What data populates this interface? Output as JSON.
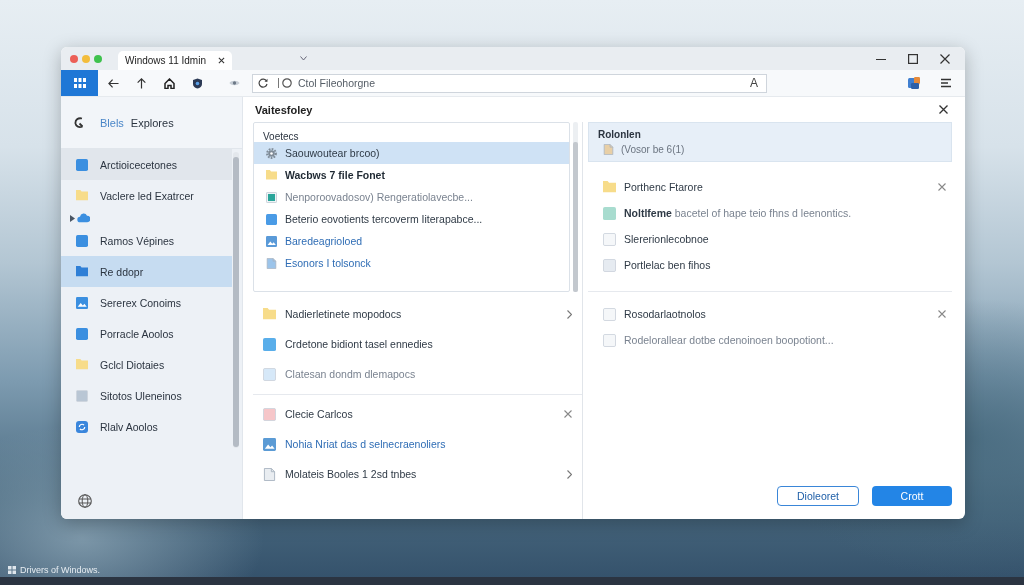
{
  "window": {
    "tabs": [
      {
        "label": "Windows 11 Idmin",
        "selected": true
      }
    ]
  },
  "toolbar": {
    "address": "Ctol Fileohorgne",
    "reader_glyph": "A"
  },
  "sidebar": {
    "link": "Blels",
    "title": "Explores",
    "items": [
      {
        "kind": "item",
        "label": "Arctioicecetones",
        "color": "#3b8fe0",
        "selected": false,
        "hovered": true
      },
      {
        "kind": "item",
        "label": "Vaclere led Exatrcer",
        "color": "#f7dc8a",
        "selected": false,
        "hovered": false
      },
      {
        "kind": "expander",
        "color": "#3b8fe0",
        "expanded": false
      },
      {
        "kind": "item",
        "label": "Ramos Vépines",
        "color": "#3b8fe0",
        "selected": false,
        "hovered": false
      },
      {
        "kind": "item",
        "label": "Re ddopr",
        "color": "#2f7fd6",
        "selected": true,
        "hovered": false
      },
      {
        "kind": "item",
        "label": "Sererex Conoims",
        "color": "#3b8fe0",
        "selected": false,
        "hovered": false
      },
      {
        "kind": "item",
        "label": "Porracle Aoolos",
        "color": "#3b8fe0",
        "selected": false,
        "hovered": false
      },
      {
        "kind": "item",
        "label": "Gclcl Diotaies",
        "color": "#f7dc8a",
        "selected": false,
        "hovered": false
      },
      {
        "kind": "item",
        "label": "Sitotos Uleneinos",
        "color": "#b9c6d4",
        "selected": false,
        "hovered": false
      },
      {
        "kind": "item",
        "label": "Rlalv Aoolos",
        "color": "#3a86dc",
        "selected": false,
        "hovered": false
      }
    ]
  },
  "main": {
    "title": "Vaitesfoley",
    "panel": {
      "heading": "Voetecs",
      "rows": [
        {
          "label": "Saouwoutear brcoo)",
          "kind": "plain",
          "color": "#7f8b97",
          "selected": true
        },
        {
          "label": "Wacbws 7 file Fonet",
          "kind": "bold",
          "color": "#f7dc8a",
          "selected": false
        },
        {
          "label": "Nenporoovadosov) Rengeratiolavecbe...",
          "kind": "muted",
          "color": "#2aa59a",
          "selected": false
        },
        {
          "label": "Beterio eovotients tercoverm Iiterapabce...",
          "kind": "plain",
          "color": "#4a9be6",
          "selected": false
        },
        {
          "label": "Baredeagrioloed",
          "kind": "link",
          "color": "#5a9ad8",
          "selected": false
        },
        {
          "label": "Esonors I tolsonck",
          "kind": "link",
          "color": "#9cc4ea",
          "selected": false
        }
      ]
    },
    "lists": [
      {
        "rows": [
          {
            "label": "Nadierletinete mopodocs",
            "kind": "plain",
            "color": "#f7dc8a",
            "expandable": true,
            "removable": false
          },
          {
            "label": "Crdetone bidiont tasel ennedies",
            "kind": "plain",
            "color": "#59aeea",
            "expandable": false,
            "removable": false
          },
          {
            "label": "Clatesan dondm dlemapocs",
            "kind": "muted",
            "color": "#d6e8f8",
            "expandable": false,
            "removable": false
          }
        ]
      },
      {
        "rows": [
          {
            "label": "Clecie Carlcos",
            "kind": "plain",
            "color": "#f6c6c9",
            "expandable": false,
            "removable": true
          },
          {
            "label": "Nohia Nriat das d selnecraenoliers",
            "kind": "link",
            "color": "#5b9bd5",
            "expandable": false,
            "removable": false
          },
          {
            "label": "Molateis Booles 1 2sd tnbes",
            "kind": "plain",
            "color": "#e9edf1",
            "expandable": true,
            "removable": false
          }
        ]
      }
    ]
  },
  "details": {
    "title": "Rolonlen",
    "subtitle": "(Vosor be 6(1)",
    "lists": [
      {
        "rows": [
          {
            "label": "Porthenc Ftarore",
            "kind": "plain",
            "color": "#f7dc8a",
            "expandable": false,
            "removable": true
          },
          {
            "label": "**Noltlfeme** bacetel of hape teio fhns d leenontics.",
            "kind": "muted",
            "color": "#a8dccf",
            "expandable": false,
            "removable": false
          },
          {
            "label": "Slererionlecobnoe",
            "kind": "plain",
            "color": "#f5f7f9",
            "expandable": false,
            "removable": false
          },
          {
            "label": "Portlelac ben fihos",
            "kind": "plain",
            "color": "#e6ebf1",
            "expandable": false,
            "removable": false
          }
        ]
      },
      {
        "rows": [
          {
            "label": "Rosodarlaotnolos",
            "kind": "plain",
            "color": "#f5f7f9",
            "expandable": false,
            "removable": true
          },
          {
            "label": "Rodelorallear dotbe cdenoinoen boopotiont...",
            "kind": "muted",
            "color": "#f5f7f9",
            "expandable": false,
            "removable": false
          }
        ]
      }
    ],
    "buttons": [
      {
        "label": "Dioleoret",
        "kind": "secondary"
      },
      {
        "label": "Crott",
        "kind": "primary"
      }
    ]
  },
  "taskbar": {
    "caption": "Drivers of Windows."
  }
}
